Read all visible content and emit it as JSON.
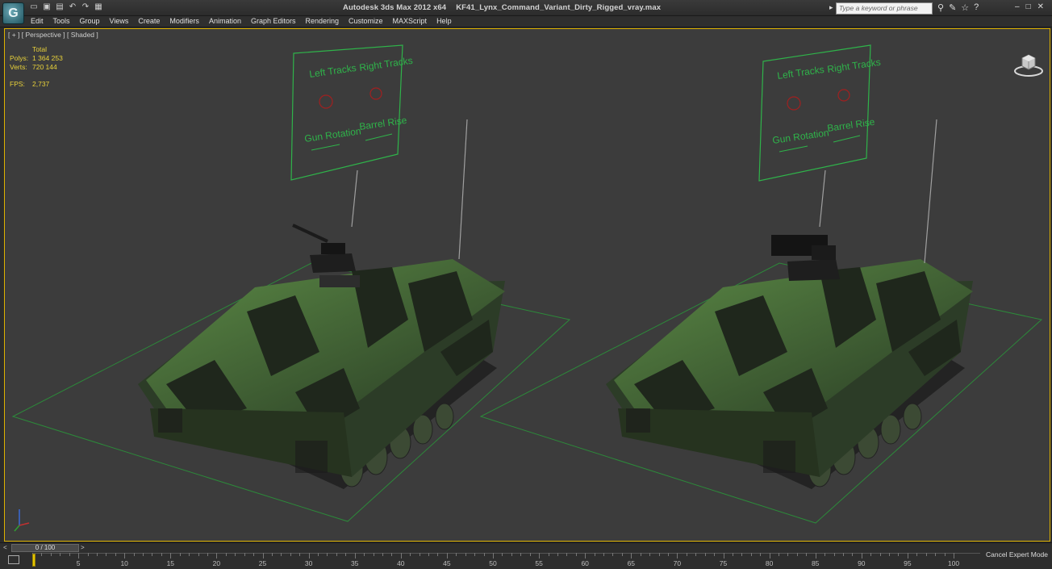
{
  "app": {
    "logo_letter": "G",
    "title": "Autodesk 3ds Max  2012 x64",
    "filename": "KF41_Lynx_Command_Variant_Dirty_Rigged_vray.max",
    "search_placeholder": "Type a keyword or phrase"
  },
  "quick_access": [
    "new-icon",
    "open-icon",
    "save-icon",
    "undo-icon",
    "redo-icon",
    "project-icon"
  ],
  "menu": [
    "Edit",
    "Tools",
    "Group",
    "Views",
    "Create",
    "Modifiers",
    "Animation",
    "Graph Editors",
    "Rendering",
    "Customize",
    "MAXScript",
    "Help"
  ],
  "viewport": {
    "label": "[ + ] [ Perspective ] [ Shaded ]",
    "stats": {
      "header": "Total",
      "polys_label": "Polys:",
      "polys_value": "1 364 253",
      "verts_label": "Verts:",
      "verts_value": "720 144",
      "fps_label": "FPS:",
      "fps_value": "2,737"
    },
    "rig_panel": {
      "left_tracks": "Left Tracks",
      "right_tracks": "Right Tracks",
      "gun_rotation": "Gun Rotation",
      "barrel_rise": "Barrel Rise"
    },
    "colors": {
      "border": "#ddb200",
      "rig_green": "#2fb34a",
      "stats_yellow": "#e9d23a",
      "camo_light": "#4f7d3a",
      "camo_dark": "#1e2a1c"
    }
  },
  "timeline": {
    "slider": "0 / 100",
    "ticks": [
      "0",
      "5",
      "10",
      "15",
      "20",
      "25",
      "30",
      "35",
      "40",
      "45",
      "50",
      "55",
      "60",
      "65",
      "70",
      "75",
      "80",
      "85",
      "90",
      "95",
      "100"
    ],
    "expert_button": "Cancel Expert Mode"
  }
}
